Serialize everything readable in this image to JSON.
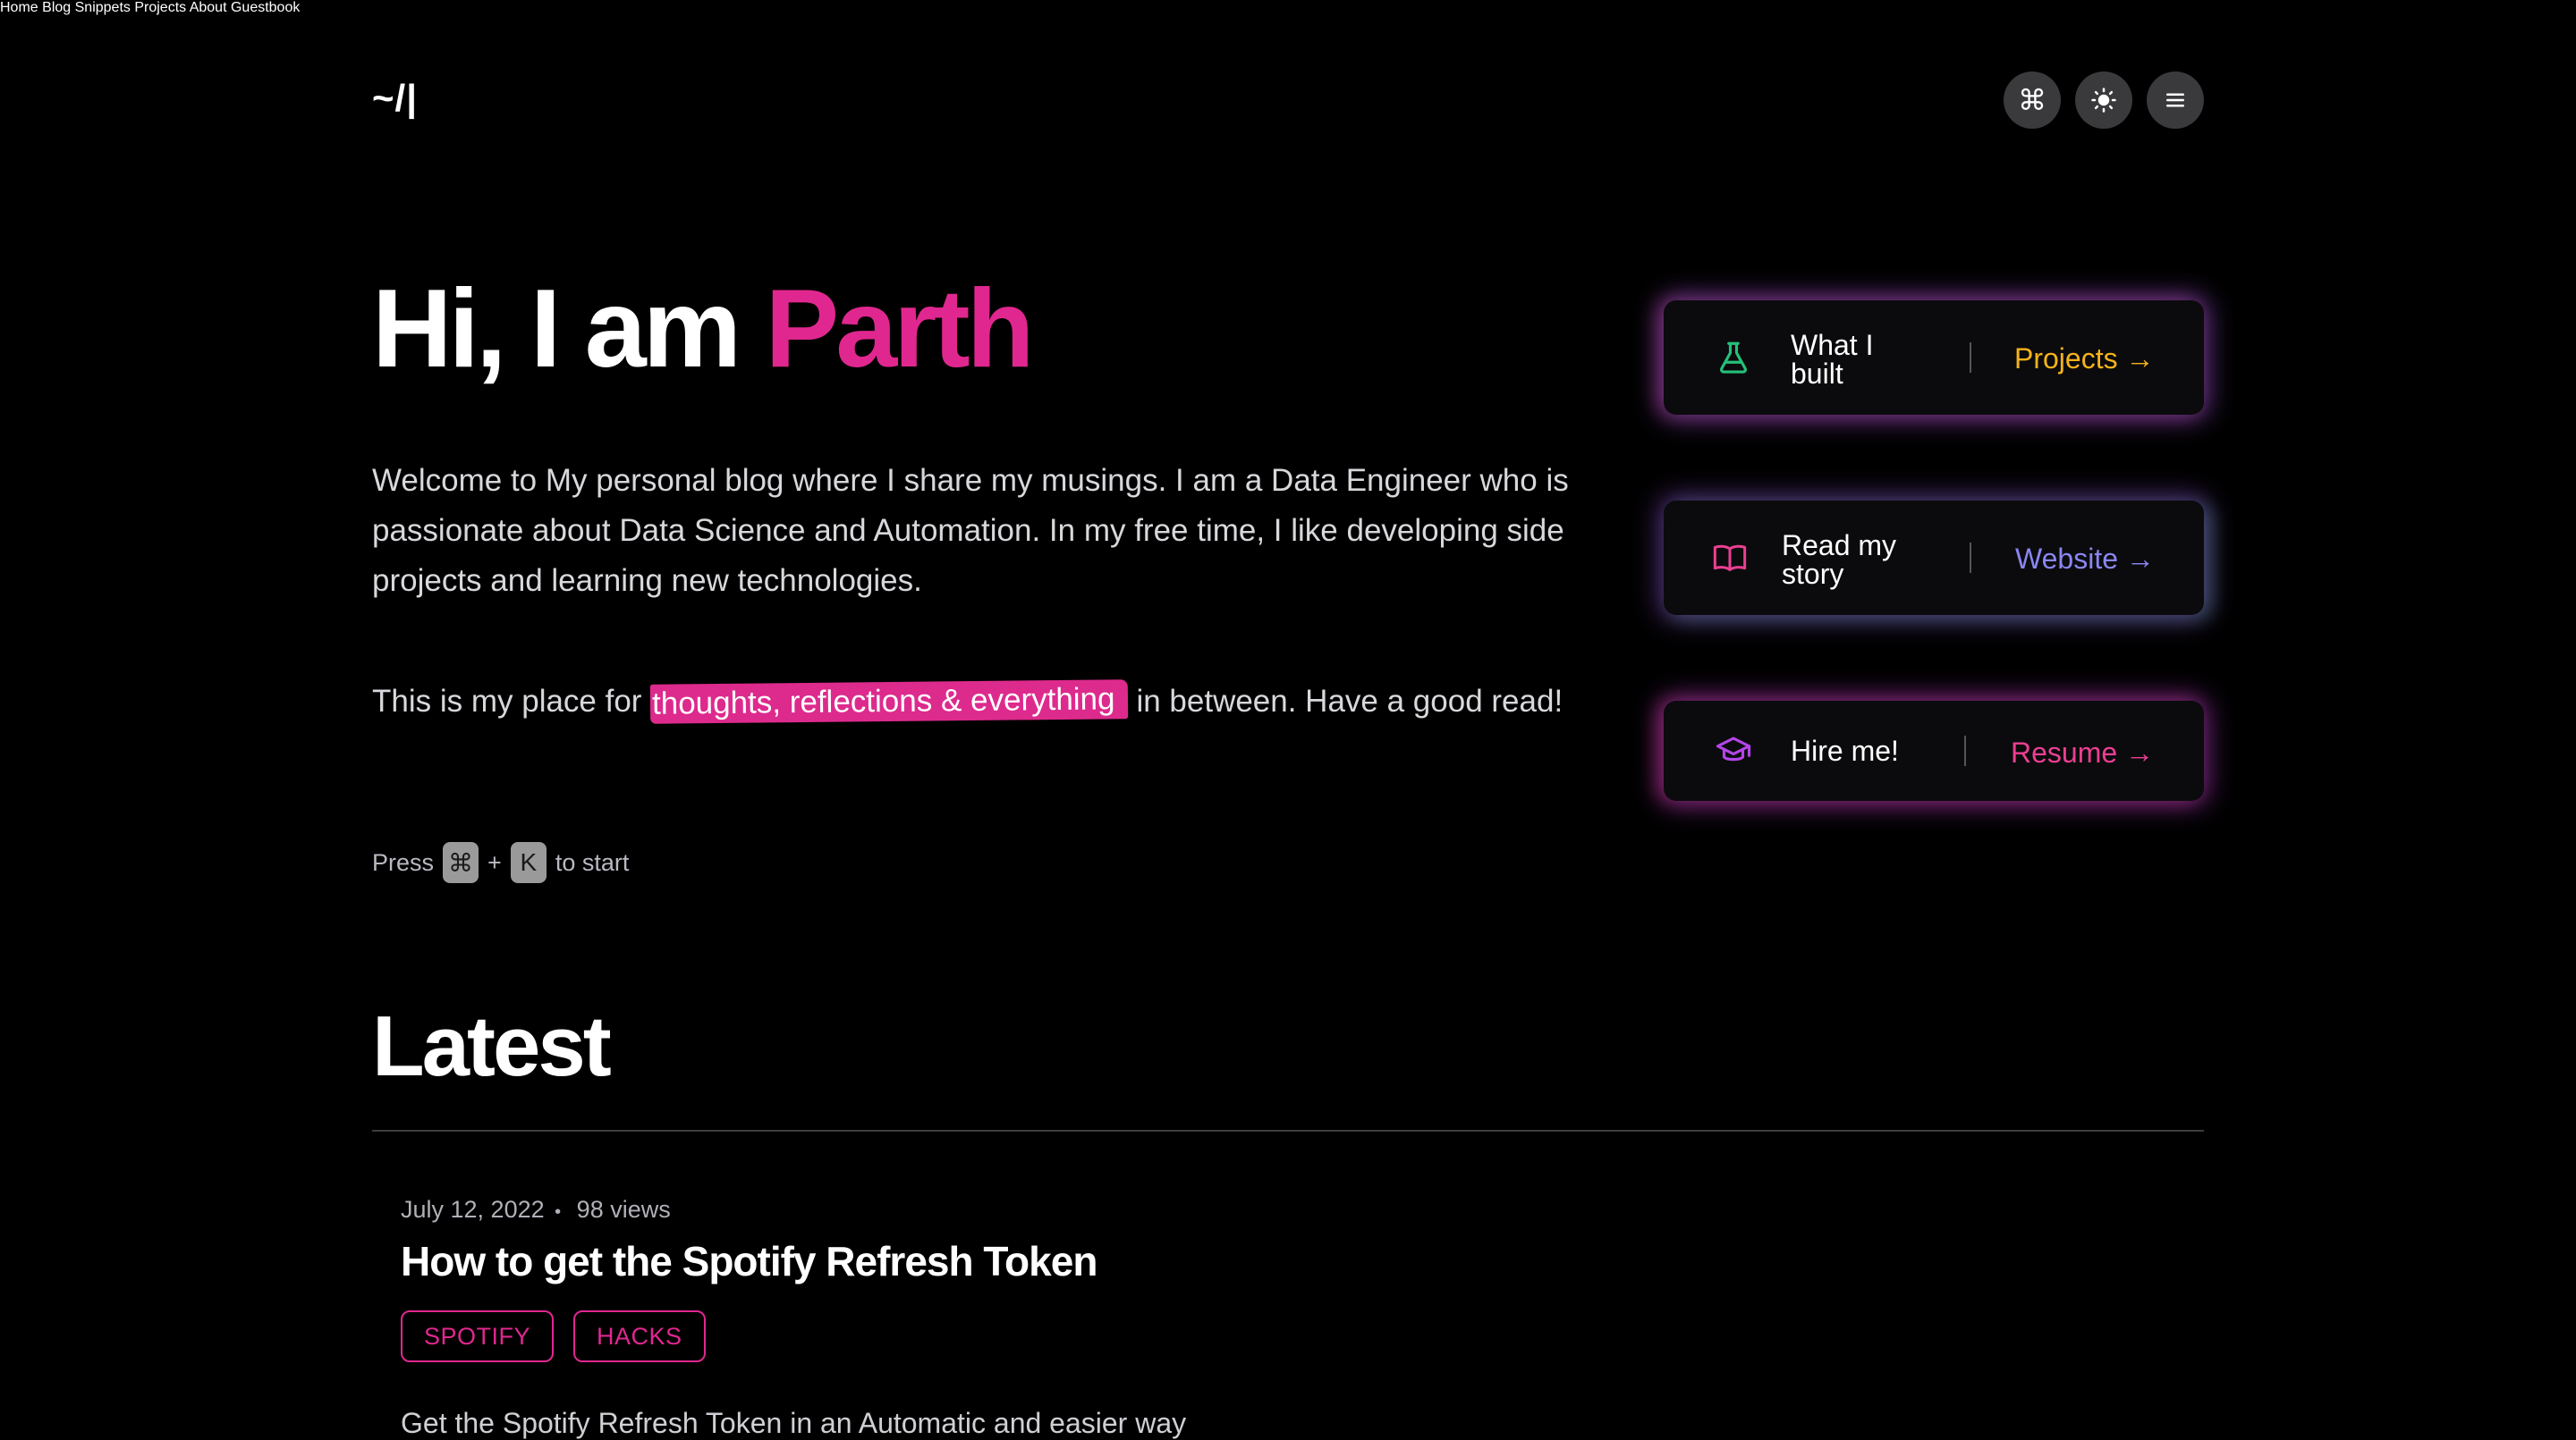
{
  "header": {
    "logo": "~/|",
    "nav": [
      "Home",
      "Blog",
      "Snippets",
      "Projects",
      "About",
      "Guestbook"
    ],
    "buttons": {
      "command": "⌘",
      "theme": "☀",
      "menu": "☰"
    }
  },
  "hero": {
    "greeting": "Hi, I am ",
    "name": "Parth",
    "intro": "Welcome to My personal blog where I share my musings. I am a Data Engineer who is passionate about Data Science and Automation. In my free time, I like developing side projects and learning new technologies.",
    "para2_before": "This is my place for ",
    "para2_highlight": "thoughts, reflections & everything",
    "para2_after": " in between. Have a good read!",
    "press_label": "Press",
    "key1": "⌘",
    "plus": "+",
    "key2": "K",
    "press_suffix": "to start"
  },
  "cards": [
    {
      "label": "What I built",
      "link": "Projects →",
      "link_color": "#f5b21b",
      "icon": "beaker-icon"
    },
    {
      "label": "Read my story",
      "link": "Website →",
      "link_color": "#8a86f0",
      "icon": "book-icon"
    },
    {
      "label": "Hire me!",
      "link": "Resume →",
      "link_color": "#ec3f92",
      "icon": "graduation-cap-icon"
    }
  ],
  "latest": {
    "heading": "Latest",
    "post": {
      "date": "July 12, 2022",
      "dot": "•",
      "views": "98 views",
      "title": "How to get the Spotify Refresh Token",
      "tags": [
        "SPOTIFY",
        "HACKS"
      ],
      "excerpt": "Get the Spotify Refresh Token in an Automatic and easier way"
    }
  },
  "colors": {
    "accent": "#e0278f",
    "background": "#000000"
  }
}
